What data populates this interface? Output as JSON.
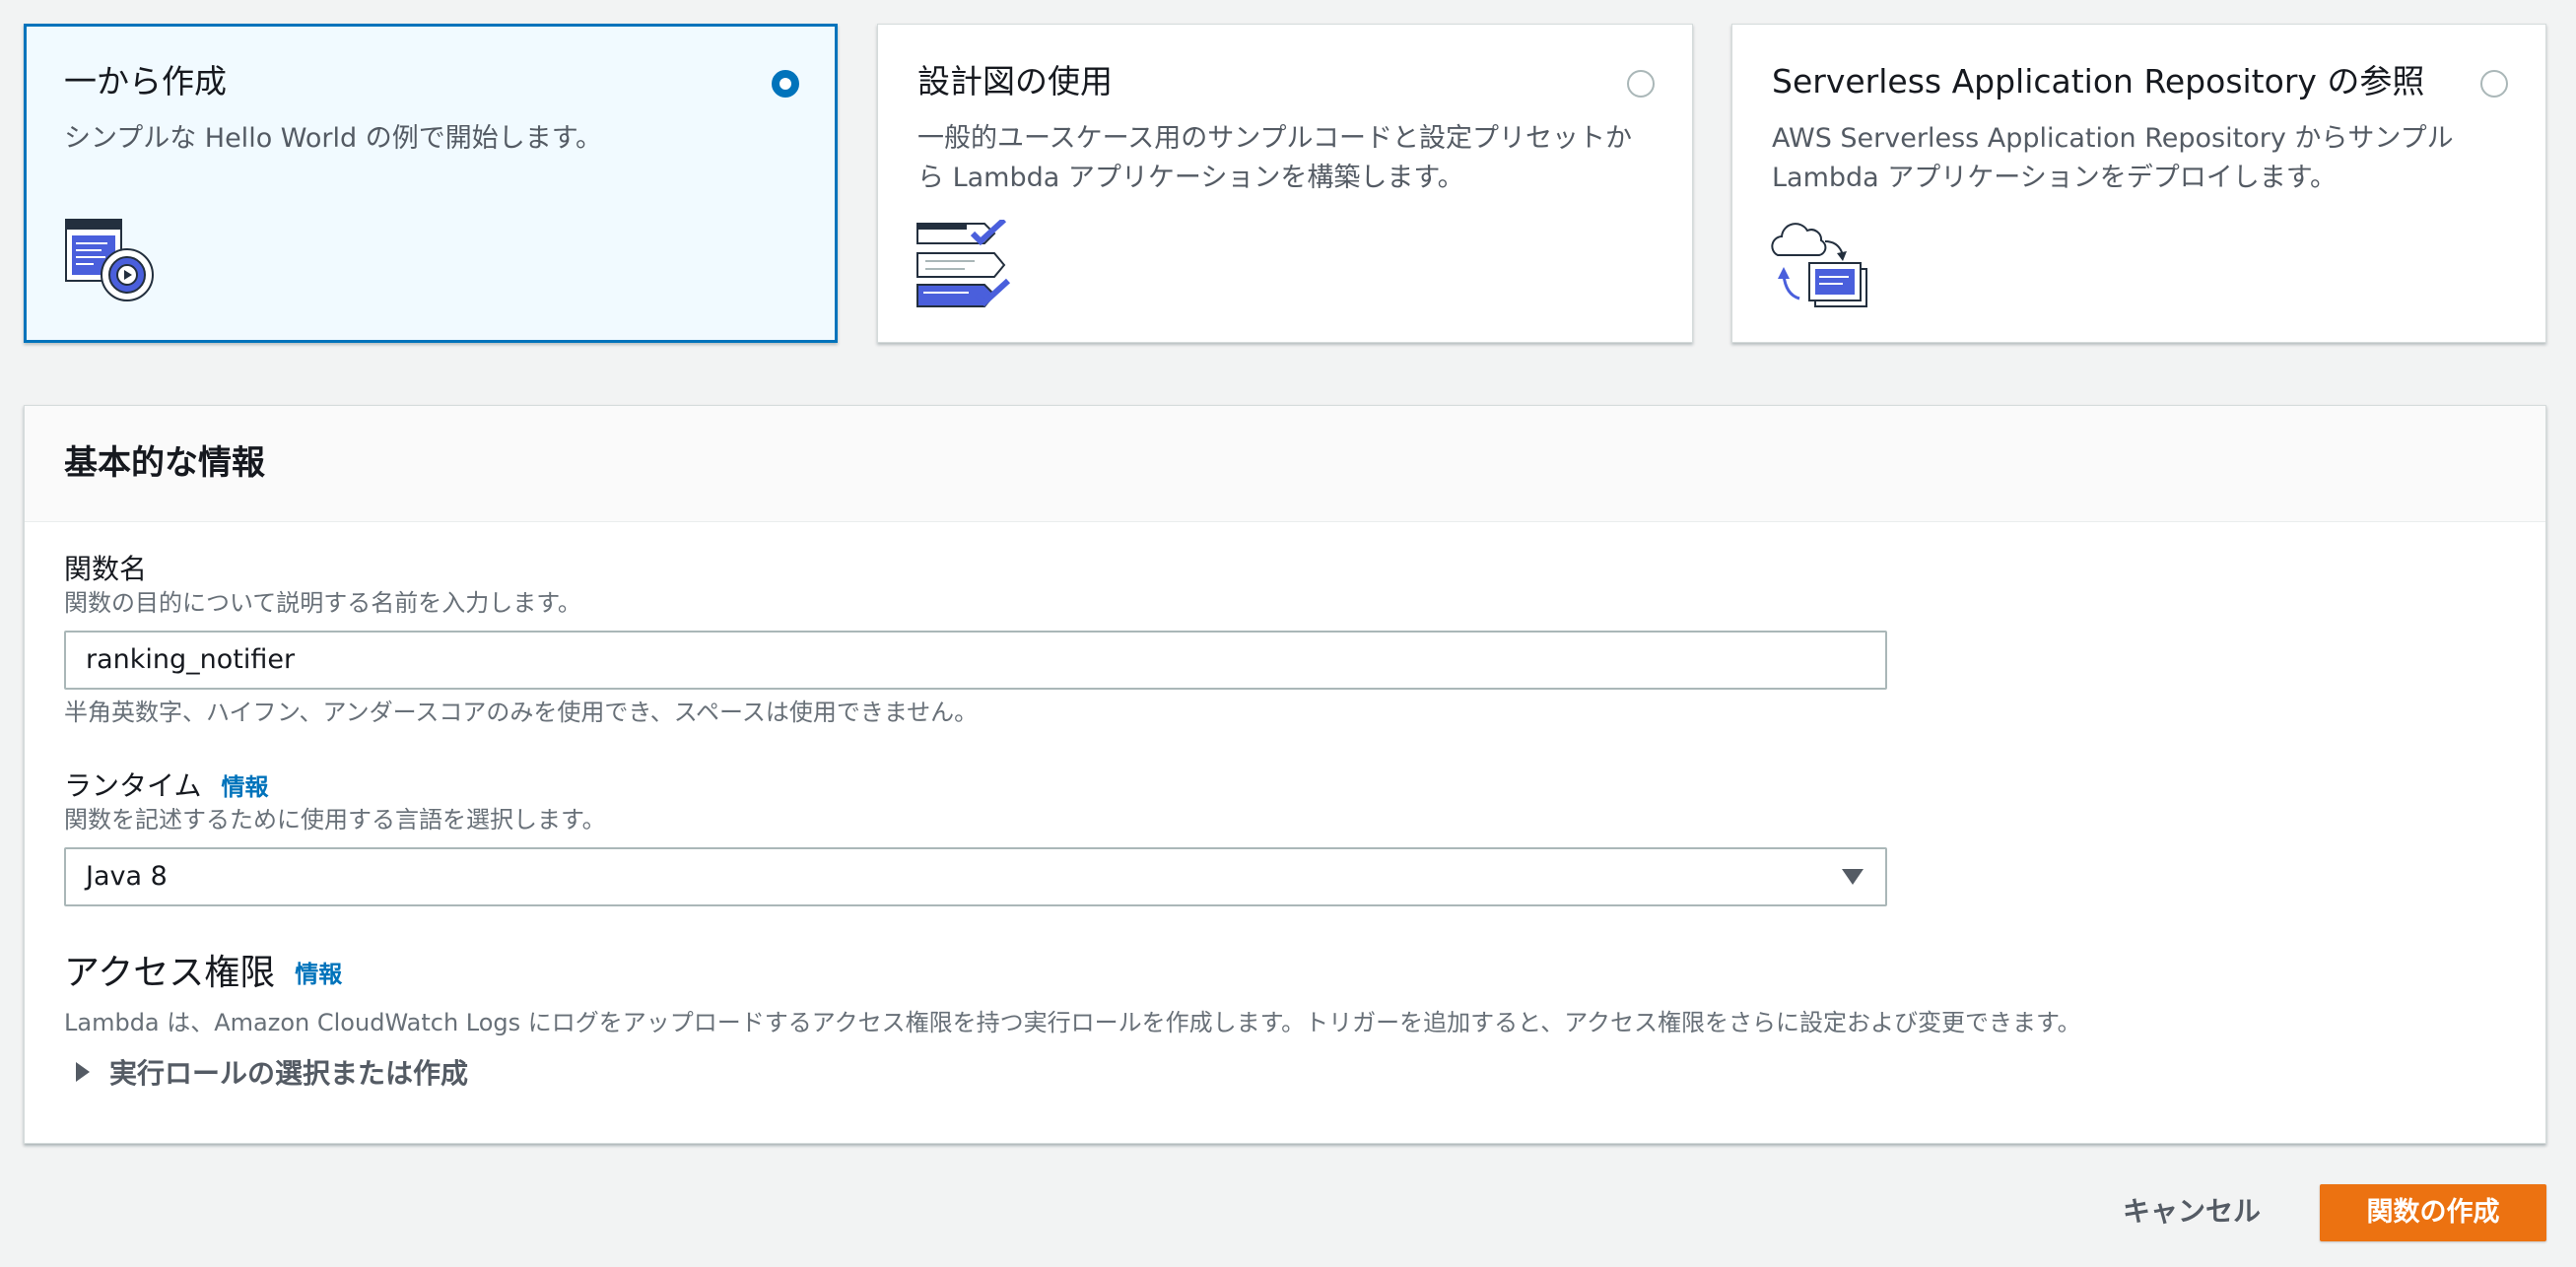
{
  "options": {
    "from_scratch": {
      "title": "一から作成",
      "desc": "シンプルな Hello World の例で開始します。",
      "selected": true
    },
    "blueprint": {
      "title": "設計図の使用",
      "desc": "一般的ユースケース用のサンプルコードと設定プリセットから Lambda アプリケーションを構築します。",
      "selected": false
    },
    "serverless_repo": {
      "title": "Serverless Application Repository の参照",
      "desc": "AWS Serverless Application Repository からサンプル Lambda アプリケーションをデプロイします。",
      "selected": false
    }
  },
  "basic_info": {
    "title": "基本的な情報",
    "function_name": {
      "label": "関数名",
      "description": "関数の目的について説明する名前を入力します。",
      "value": "ranking_notifier",
      "hint": "半角英数字、ハイフン、アンダースコアのみを使用でき、スペースは使用できません。"
    },
    "runtime": {
      "label": "ランタイム",
      "info": "情報",
      "description": "関数を記述するために使用する言語を選択します。",
      "value": "Java 8"
    },
    "permissions": {
      "title": "アクセス権限",
      "info": "情報",
      "description": "Lambda は、Amazon CloudWatch Logs にログをアップロードするアクセス権限を持つ実行ロールを作成します。トリガーを追加すると、アクセス権限をさらに設定および変更できます。",
      "expander": "実行ロールの選択または作成"
    }
  },
  "footer": {
    "cancel": "キャンセル",
    "create": "関数の作成"
  },
  "colors": {
    "accent": "#0073bb",
    "primary_button": "#ec7211",
    "icon_blue": "#4a5fdc"
  }
}
